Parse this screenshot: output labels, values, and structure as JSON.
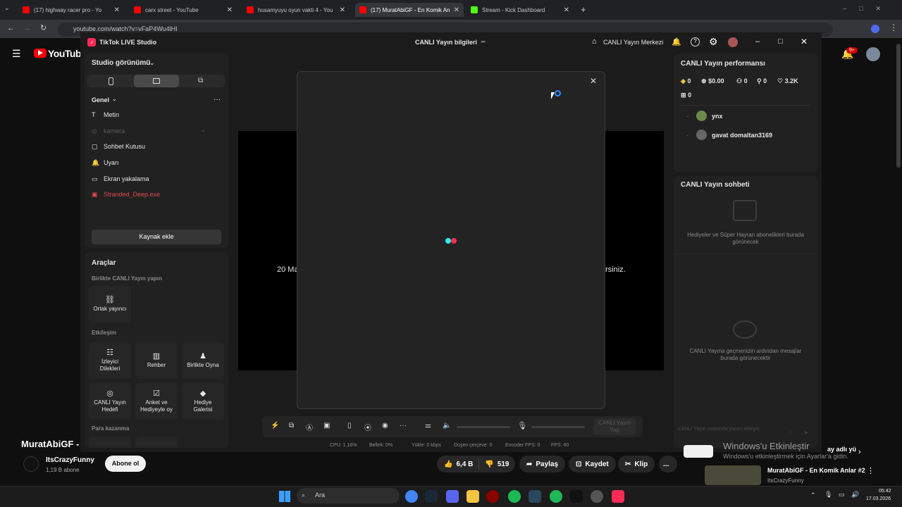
{
  "browser": {
    "tabs": [
      {
        "title": "(17) highway racer pro - Yo",
        "active": false
      },
      {
        "title": "carx street - YouTube",
        "active": false
      },
      {
        "title": "husamyuyu oyun vakti 4 - You",
        "active": false
      },
      {
        "title": "(17) MuratAbiGF - En Komik An",
        "active": true
      },
      {
        "title": "Stream - Kick Dashboard",
        "active": false
      }
    ],
    "url": "youtube.com/watch?v=vFaP4Wu4lHI"
  },
  "youtube": {
    "logo_text": "YouTube",
    "notification_badge": "9+",
    "video_title": "MuratAbiGF -",
    "channel_name": "ItsCrazyFunny",
    "subscribers": "1,19 B abone",
    "subscribe_label": "Abone ol",
    "likes": "6,4 B",
    "dislikes": "519",
    "share_label": "Paylaş",
    "save_label": "Kaydet",
    "clip_label": "Klip",
    "more_label": "...",
    "related_title": "MuratAbiGF - En Komik Anlar #2",
    "related_channel": "ItsCrazyFunny",
    "chip_label": "ay adlı yü",
    "windows_activate_title": "Windows'u Etkinleştir",
    "windows_activate_sub": "Windows'u etkinleştirmek için Ayarlar'a gidin."
  },
  "studio": {
    "app_title": "TikTok LIVE Studio",
    "center_title": "CANLI Yayın bilgileri",
    "live_center": "CANLI Yayın Merkezi",
    "studio_view": "Studio görünümü",
    "general": "Genel",
    "sources": [
      {
        "label": "Metin",
        "icon": "T",
        "state": "normal"
      },
      {
        "label": "kamera",
        "icon": "◎",
        "state": "disabled"
      },
      {
        "label": "Sohbet Kutusu",
        "icon": "▢",
        "state": "normal"
      },
      {
        "label": "Uyarı",
        "icon": "🔔",
        "state": "normal"
      },
      {
        "label": "Ekran yakalama",
        "icon": "▭",
        "state": "normal"
      },
      {
        "label": "Stranded_Deep.exe",
        "icon": "▣",
        "state": "error"
      }
    ],
    "add_source": "Kaynak ekle",
    "tools_title": "Araçlar",
    "collab_title": "Birlikte CANLI Yayın yapın",
    "co_host": "Ortak yayıncı",
    "interaction_title": "Etkileşim",
    "interaction_tools": [
      {
        "label": "İzleyici\nDilekleri",
        "icon": "☷"
      },
      {
        "label": "Rehber",
        "icon": "▥"
      },
      {
        "label": "Birlikte Oyna",
        "icon": "♟"
      },
      {
        "label": "CANLI Yayın\nHedefi",
        "icon": "◎"
      },
      {
        "label": "Anket ve\nHediyeyle oy",
        "icon": "☑"
      },
      {
        "label": "Hediye\nGalerisi",
        "icon": "◆"
      }
    ],
    "money_title": "Para kazanma",
    "preview_text_left": "20 Ma",
    "preview_text_right": "rsiniz.",
    "performance_title": "CANLI Yayın performansı",
    "stats": {
      "diamonds": "0",
      "money": "$0.00",
      "viewers": "0",
      "followers": "0",
      "likes": "3.2K",
      "gifts": "0"
    },
    "viewers_list": [
      {
        "name": "ynx"
      },
      {
        "name": "gavat domaltan3169"
      }
    ],
    "chat_title": "CANLI Yayın sohbeti",
    "gifts_empty": "Hediyeler ve Süper Hayran abonelikleri burada görünecek",
    "chat_empty": "CANLI Yayına geçmenizin ardından mesajlar burada görünecektir",
    "chat_placeholder": "CANLI Yayın sırasında yorum ekleyin",
    "go_live": "CANLI Yayın Yap",
    "status": {
      "cpu": "CPU:  1.16%",
      "memory": "Bellek:  0%",
      "upload": "Yükle:  0 kbps",
      "dropped": "Düşen çerçeve:  0",
      "encoder": "Encoder FPS:  0",
      "fps": "FPS:  60"
    }
  },
  "taskbar": {
    "search": "Ara",
    "time": "05:42",
    "date": "17.03.2026"
  },
  "colors": {
    "accent_red": "#ff0000",
    "tiktok_cyan": "#25f4ee",
    "tiktok_pink": "#fe2c55",
    "error_red": "#e0494f"
  }
}
